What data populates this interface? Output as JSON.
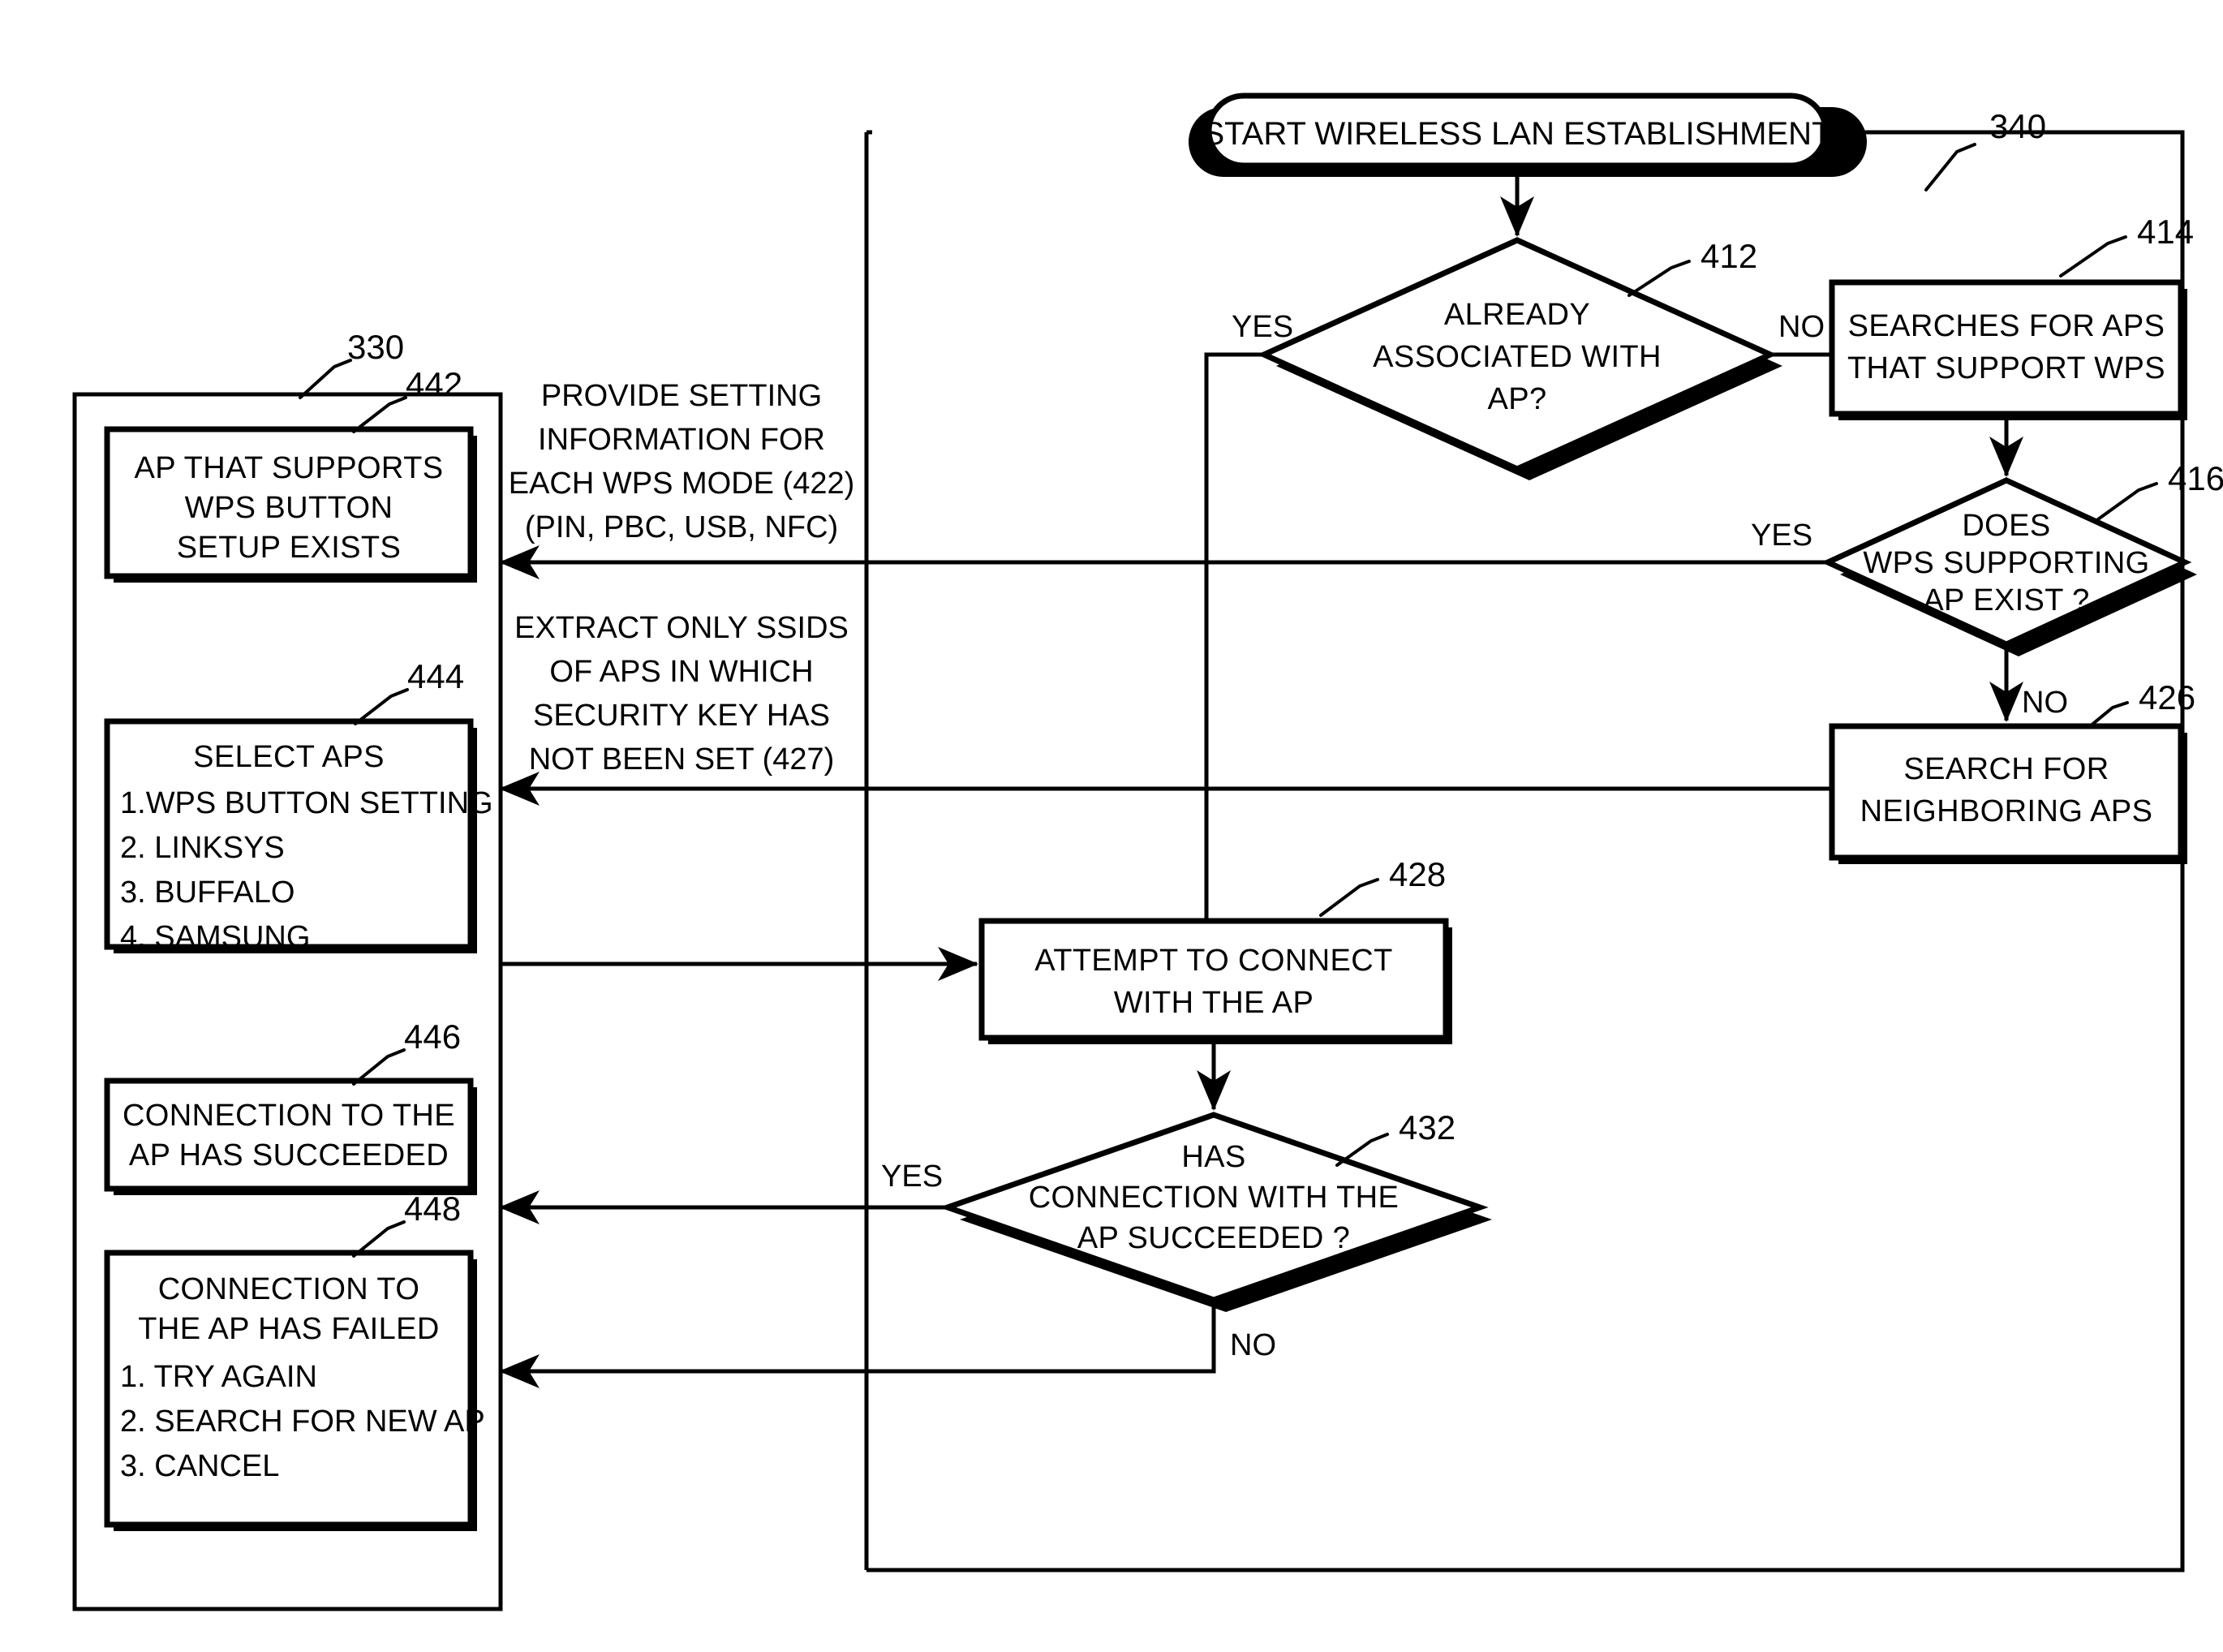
{
  "figure": {
    "type": "patent-flowchart",
    "overall_ref": "340",
    "background": "#ffffff",
    "ink": "#000000"
  },
  "nodes": {
    "start": {
      "ref": "340",
      "shape": "stadium",
      "text": "START WIRELESS LAN ESTABLISHMENT"
    },
    "d412": {
      "ref": "412",
      "shape": "diamond",
      "line1": "ALREADY",
      "line2": "ASSOCIATED WITH",
      "line3": "AP?",
      "yes_label": "YES",
      "no_label": "NO"
    },
    "p414": {
      "ref": "414",
      "shape": "process",
      "line1": "SEARCHES FOR APS",
      "line2": "THAT SUPPORT WPS"
    },
    "d416": {
      "ref": "416",
      "shape": "diamond",
      "line1": "DOES",
      "line2": "WPS SUPPORTING",
      "line3": "AP EXIST ?",
      "yes_label": "YES",
      "no_label": "NO"
    },
    "p426": {
      "ref": "426",
      "shape": "process",
      "line1": "SEARCH FOR",
      "line2": "NEIGHBORING APS"
    },
    "p428": {
      "ref": "428",
      "shape": "process",
      "line1": "ATTEMPT TO CONNECT",
      "line2": "WITH THE AP"
    },
    "d432": {
      "ref": "432",
      "shape": "diamond",
      "line1": "HAS",
      "line2": "CONNECTION WITH THE",
      "line3": "AP SUCCEEDED ?",
      "yes_label": "YES",
      "no_label": "NO"
    }
  },
  "ui_panel": {
    "ref": "330",
    "screens": [
      {
        "ref": "442",
        "lines": [
          "AP THAT SUPPORTS",
          "WPS BUTTON",
          "SETUP EXISTS"
        ],
        "items": []
      },
      {
        "ref": "444",
        "lines": [
          "SELECT APS"
        ],
        "items": [
          "1.WPS BUTTON SETTING",
          "2. LINKSYS",
          "3. BUFFALO",
          "4. SAMSUNG"
        ]
      },
      {
        "ref": "446",
        "lines": [
          "CONNECTION TO THE",
          "AP HAS SUCCEEDED"
        ],
        "items": []
      },
      {
        "ref": "448",
        "lines": [
          "CONNECTION TO",
          "THE AP HAS FAILED"
        ],
        "items": [
          "1. TRY AGAIN",
          "2. SEARCH FOR NEW AP",
          "3. CANCEL"
        ]
      }
    ]
  },
  "annotations": [
    {
      "ref": "422",
      "lines": [
        "PROVIDE SETTING",
        "INFORMATION FOR",
        "EACH WPS MODE (422)",
        "(PIN, PBC, USB, NFC)"
      ]
    },
    {
      "ref": "427",
      "lines": [
        "EXTRACT ONLY SSIDS",
        "OF APS IN WHICH",
        "SECURITY KEY HAS",
        "NOT BEEN SET (427)"
      ]
    }
  ],
  "edge_labels": {
    "d412_yes": "YES",
    "d412_no": "NO",
    "d416_yes": "YES",
    "d416_no": "NO",
    "d432_yes": "YES",
    "d432_no": "NO"
  },
  "reference_numerals": [
    "330",
    "340",
    "412",
    "414",
    "416",
    "422",
    "426",
    "427",
    "428",
    "432",
    "442",
    "444",
    "446",
    "448"
  ]
}
